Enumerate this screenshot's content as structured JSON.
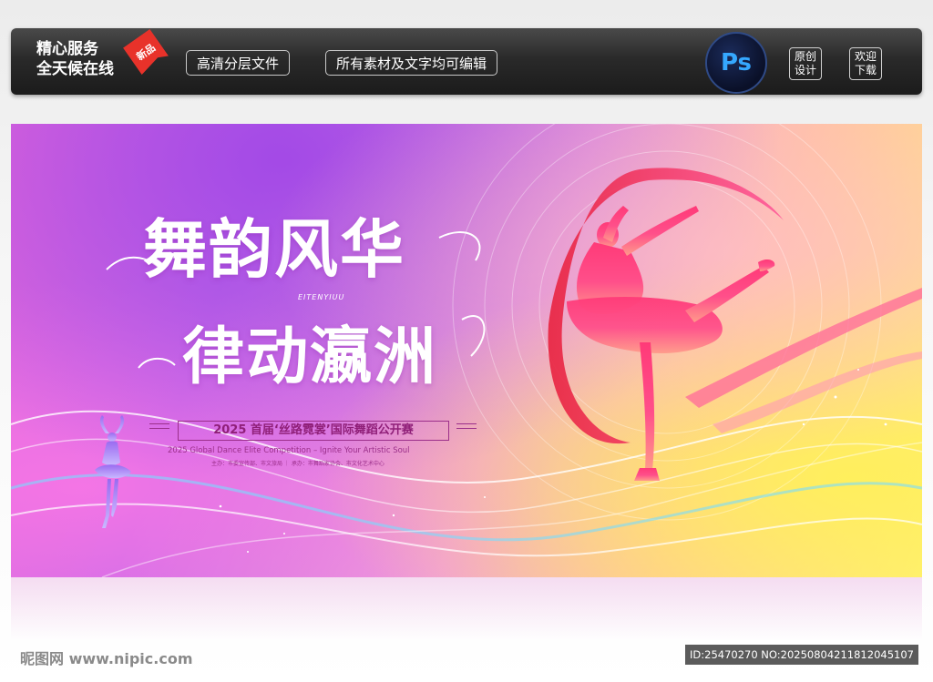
{
  "topbar": {
    "service_line1": "精心服务",
    "service_line2": "全天候在线",
    "new_badge": "新品",
    "feature1": "高清分层文件",
    "feature2": "所有素材及文字均可编辑",
    "ps_label": "Ps",
    "original_line1": "原创",
    "original_line2": "设计",
    "welcome_line1": "欢迎",
    "welcome_line2": "下载"
  },
  "banner": {
    "title_line1": "舞韵风华",
    "title_line2": "律动瀛洲",
    "title_en": "EITENYIUU",
    "event_title": "2025 首届‘丝路霓裳’国际舞蹈公开赛",
    "event_en": "2025 Global Dance Elite Competition – Ignite Your Artistic Soul",
    "organizers": "主办：市委宣传部、市文旅局 ｜ 承办：市舞蹈家协会、市文化艺术中心"
  },
  "footer": {
    "site": "昵图网 www.nipic.com",
    "id_text": "ID:25470270 NO:20250804211812045107"
  },
  "colors": {
    "accent_purple": "#9b2f8a",
    "ribbon_red": "#e8223f",
    "ps_blue": "#35a8ff"
  }
}
